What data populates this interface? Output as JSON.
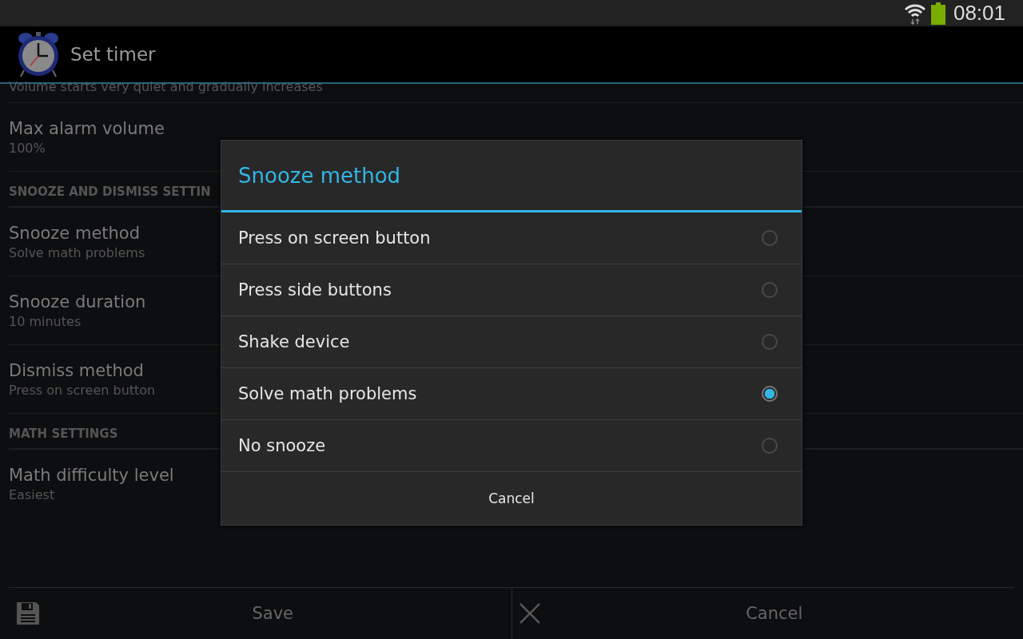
{
  "status_bar": {
    "time": "08:01"
  },
  "action_bar": {
    "title": "Set timer"
  },
  "settings": [
    {
      "kind": "note",
      "text": "Volume starts very quiet and gradually increases"
    },
    {
      "kind": "preference",
      "title": "Max alarm volume",
      "summary": "100%"
    },
    {
      "kind": "header",
      "text": "SNOOZE AND DISMISS SETTIN"
    },
    {
      "kind": "preference",
      "title": "Snooze method",
      "summary": "Solve math problems"
    },
    {
      "kind": "preference",
      "title": "Snooze duration",
      "summary": "10 minutes"
    },
    {
      "kind": "preference",
      "title": "Dismiss method",
      "summary": "Press on screen button"
    },
    {
      "kind": "header",
      "text": "MATH SETTINGS"
    },
    {
      "kind": "preference",
      "title": "Math difficulty level",
      "summary": "Easiest"
    }
  ],
  "dialog": {
    "title": "Snooze method",
    "options": [
      {
        "label": "Press on screen button",
        "selected": false
      },
      {
        "label": "Press side buttons",
        "selected": false
      },
      {
        "label": "Shake device",
        "selected": false
      },
      {
        "label": "Solve math problems",
        "selected": true
      },
      {
        "label": "No snooze",
        "selected": false
      }
    ],
    "cancel": "Cancel"
  },
  "bottom_bar": {
    "save": "Save",
    "cancel": "Cancel"
  }
}
